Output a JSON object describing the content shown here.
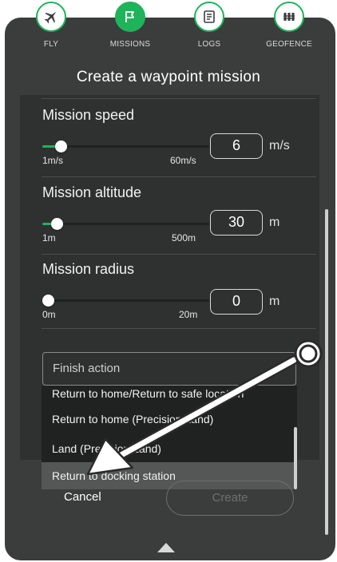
{
  "nav": [
    {
      "label": "FLY",
      "icon": "airplane-icon",
      "active": false
    },
    {
      "label": "MISSIONS",
      "icon": "flag-icon",
      "active": true
    },
    {
      "label": "LOGS",
      "icon": "document-icon",
      "active": false
    },
    {
      "label": "GEOFENCE",
      "icon": "fence-icon",
      "active": false
    }
  ],
  "title": "Create a waypoint mission",
  "speed": {
    "label": "Mission speed",
    "min": "1m/s",
    "max": "60m/s",
    "value": "6",
    "unit": "m/s",
    "level": 0.085
  },
  "altitude": {
    "label": "Mission altitude",
    "min": "1m",
    "max": "500m",
    "value": "30",
    "unit": "m",
    "level": 0.058
  },
  "radius": {
    "label": "Mission radius",
    "min": "0m",
    "max": "20m",
    "value": "0",
    "unit": "m",
    "level": 0.0
  },
  "finish_action": {
    "placeholder": "Finish action",
    "options": [
      "Return to home/Return to safe location",
      "Return to home (Precision Land)",
      "Land (Precision Land)",
      "Return to docking station"
    ],
    "highlighted": "Return to docking station"
  },
  "buttons": {
    "cancel": "Cancel",
    "create": "Create"
  },
  "colors": {
    "accent": "#1fb45a",
    "panel": "#3b3d3c",
    "content": "#2f3130"
  }
}
